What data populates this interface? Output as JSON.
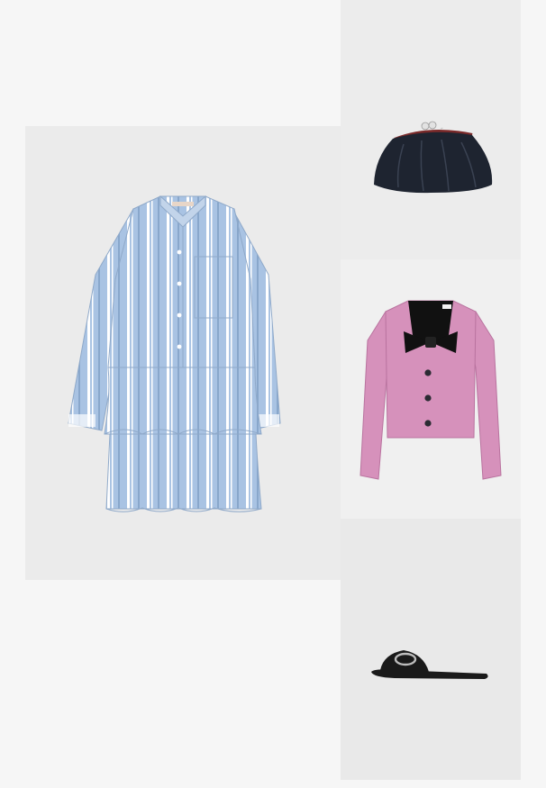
{
  "products": [
    {
      "id": "dress",
      "icon": "striped-tiered-shirt-dress",
      "colors": {
        "main": "#a9c3e3",
        "stripe": "#ffffff",
        "stripe_dark": "#6f8fb8"
      }
    },
    {
      "id": "bag",
      "icon": "black-frame-clutch-bag",
      "colors": {
        "main": "#1e2430",
        "frame": "#7a2a2a",
        "chain": "#c8c8c8"
      }
    },
    {
      "id": "jacket",
      "icon": "pink-bow-jacket",
      "colors": {
        "main": "#d691bb",
        "bow": "#111111",
        "button": "#2b2b33"
      }
    },
    {
      "id": "sandal",
      "icon": "black-slide-sandal",
      "colors": {
        "main": "#1a1a1a",
        "buckle": "#bdbdbd"
      }
    }
  ]
}
